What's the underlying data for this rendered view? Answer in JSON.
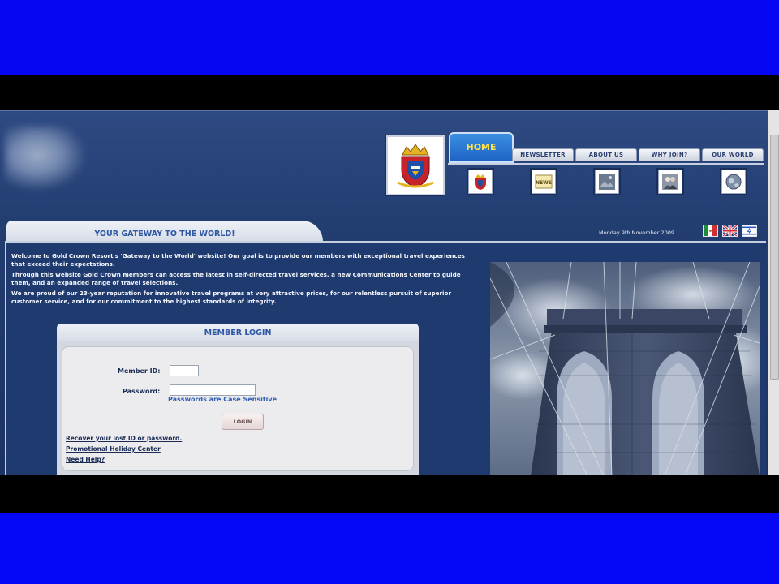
{
  "nav": {
    "tabs": [
      {
        "label": "HOME",
        "active": true
      },
      {
        "label": "NEWSLETTER"
      },
      {
        "label": "ABOUT US"
      },
      {
        "label": "WHY JOIN?"
      },
      {
        "label": "OUR WORLD"
      }
    ],
    "icons": [
      "crest-icon",
      "news-icon",
      "photo-icon",
      "people-icon",
      "globe-icon"
    ],
    "news_icon_text": "NEWS"
  },
  "banner": {
    "title": "YOUR GATEWAY TO THE WORLD!",
    "date": "Monday 9th November 2009",
    "flags": [
      "mexico-flag-icon",
      "uk-flag-icon",
      "israel-flag-icon"
    ]
  },
  "intro": {
    "p1": "Welcome to Gold Crown Resort's 'Gateway to the World' website! Our goal is to provide our members with exceptional travel experiences that exceed their expectations.",
    "p2": "Through this website Gold Crown members can access the latest in self-directed travel services, a new Communications Center to guide them, and an expanded range of travel selections.",
    "p3": "We are proud of our 23-year reputation for innovative travel programs at very attractive prices, for our relentless pursuit of superior customer service, and for our commitment to the highest standards of integrity."
  },
  "login": {
    "title": "MEMBER LOGIN",
    "member_id_label": "Member ID:",
    "member_id_value": "",
    "password_label": "Password:",
    "password_value": "",
    "case_note": "Passwords are Case Sensitive",
    "button": "LOGIN",
    "links": [
      "Recover your lost ID or password.",
      "Promotional Holiday Center",
      "Need Help?"
    ]
  },
  "colors": {
    "page_bg": "#223d70",
    "accent_blue": "#2d57a3",
    "home_tab_text": "#ffe14a",
    "letterbox_blue": "#0606f5"
  }
}
